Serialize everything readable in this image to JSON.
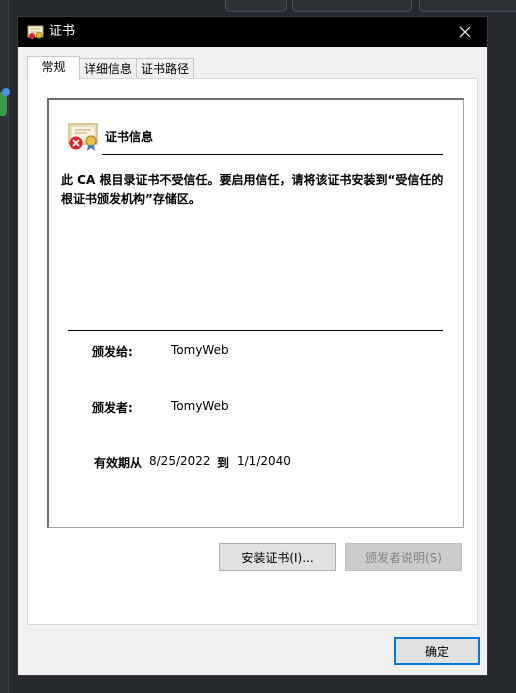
{
  "window": {
    "title": "证书",
    "close_glyph": "✕"
  },
  "tabs": [
    {
      "label": "常规",
      "active": true
    },
    {
      "label": "详细信息",
      "active": false
    },
    {
      "label": "证书路径",
      "active": false
    }
  ],
  "certificate": {
    "heading": "证书信息",
    "warning": "此 CA 根目录证书不受信任。要启用信任，请将该证书安装到“受信任的根证书颁发机构”存储区。",
    "issued_to_label": "颁发给:",
    "issued_to": "TomyWeb",
    "issued_by_label": "颁发者:",
    "issued_by": "TomyWeb",
    "valid_from_label": "有效期从",
    "valid_from": "8/25/2022",
    "valid_to_label": "到",
    "valid_to": "1/1/2040"
  },
  "buttons": {
    "install": "安装证书(I)...",
    "issuer_statement": "颁发者说明(S)",
    "ok": "确定"
  },
  "icons": {
    "title": "certificate-icon",
    "cert": "certificate-error-icon",
    "close": "close-icon"
  }
}
